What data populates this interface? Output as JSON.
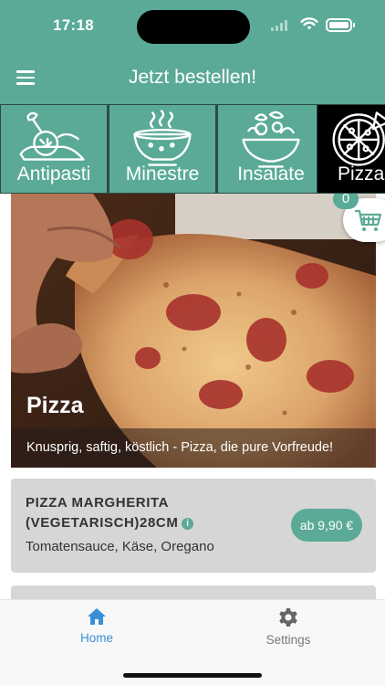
{
  "status_bar": {
    "time": "17:18"
  },
  "header": {
    "title": "Jetzt bestellen!",
    "menu_icon": "hamburger-menu-icon"
  },
  "categories": [
    {
      "label": "Antipasti",
      "icon": "antipasti-plate-icon",
      "active": false
    },
    {
      "label": "Minestre",
      "icon": "soup-bowl-icon",
      "active": false
    },
    {
      "label": "Insalate",
      "icon": "salad-bowl-icon",
      "active": false
    },
    {
      "label": "Pizza",
      "icon": "pizza-icon",
      "active": true
    }
  ],
  "cart": {
    "count": "0",
    "icon": "shopping-cart-icon"
  },
  "hero": {
    "title": "Pizza",
    "subtitle": "Knusprig, saftig, köstlich - Pizza, die pure Vorfreude!"
  },
  "items": [
    {
      "name": "PIZZA MARGHERITA (VEGETARISCH)28CM",
      "description": "Tomatensauce, Käse, Oregano",
      "price": "ab 9,90 €"
    }
  ],
  "bottom_nav": {
    "home_label": "Home",
    "settings_label": "Settings"
  },
  "colors": {
    "accent": "#5aaa97",
    "active_category": "#000000",
    "card": "#d6d6d6",
    "nav_active": "#3a8fd6",
    "nav_inactive": "#777777"
  }
}
